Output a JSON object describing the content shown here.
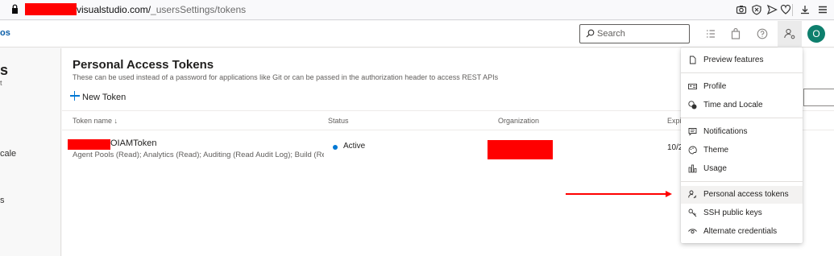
{
  "browser": {
    "url_host": "visualstudio.com/",
    "url_path": "_usersSettings/tokens"
  },
  "header": {
    "brand_fragment": "os",
    "search_placeholder": "Search",
    "avatar_initial": "O",
    "accent": "#0078d4",
    "avatar_color": "#0e7f6d"
  },
  "leftnav": {
    "title_fragment": "s",
    "subtitle_fragment": "t",
    "item_time_locale_fragment": "cale",
    "item_fragment": "s"
  },
  "main": {
    "title": "Personal Access Tokens",
    "description": "These can be used instead of a password for applications like Git or can be passed in the authorization header to access REST APIs",
    "new_token_label": "New Token",
    "columns": {
      "token_name": "Token name ↓",
      "status": "Status",
      "organization": "Organization",
      "expires": "Expir"
    },
    "rows": [
      {
        "name": "OIAMToken",
        "scopes": "Agent Pools (Read); Analytics (Read); Auditing (Read Audit Log); Build (Re",
        "status": "Active",
        "expires": "10/2"
      }
    ]
  },
  "menu": {
    "items": [
      {
        "label": "Preview features",
        "icon": "page-icon"
      },
      {
        "label": "Profile",
        "icon": "contact-card-icon"
      },
      {
        "label": "Time and Locale",
        "icon": "clock-globe-icon"
      },
      {
        "label": "Notifications",
        "icon": "message-icon"
      },
      {
        "label": "Theme",
        "icon": "palette-icon"
      },
      {
        "label": "Usage",
        "icon": "bar-chart-icon"
      },
      {
        "label": "Personal access tokens",
        "icon": "user-key-icon"
      },
      {
        "label": "SSH public keys",
        "icon": "key-icon"
      },
      {
        "label": "Alternate credentials",
        "icon": "eye-icon"
      }
    ],
    "highlighted_item": "Personal access tokens"
  }
}
